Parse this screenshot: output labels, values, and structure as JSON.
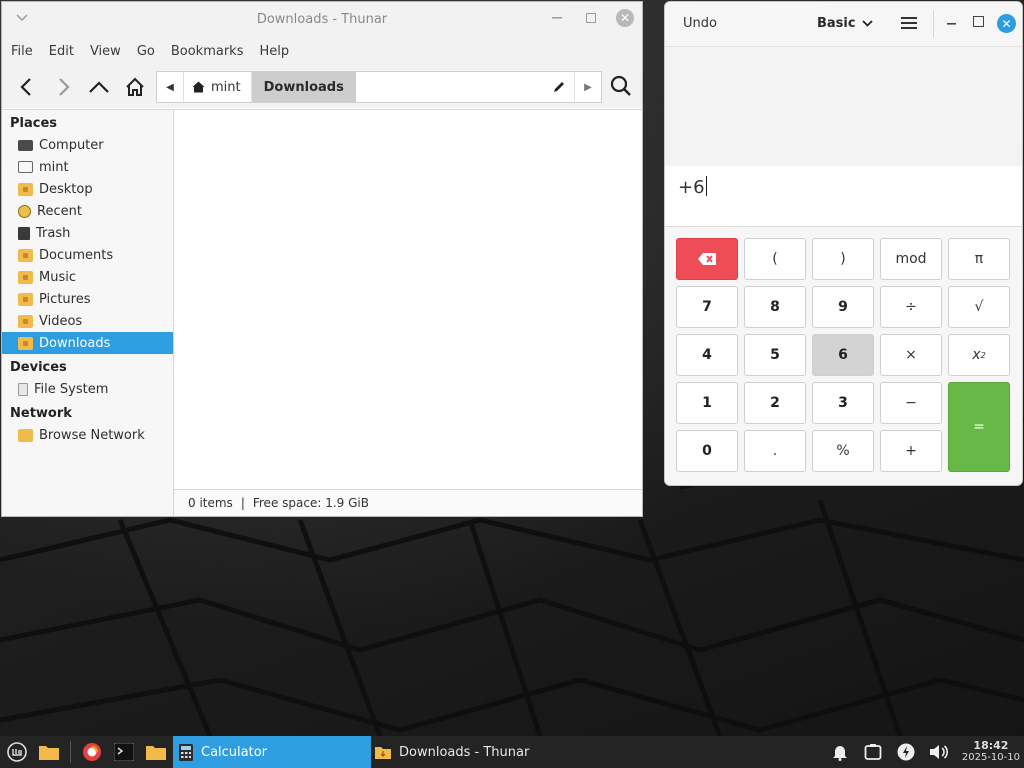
{
  "thunar": {
    "title": "Downloads - Thunar",
    "menu": [
      "File",
      "Edit",
      "View",
      "Go",
      "Bookmarks",
      "Help"
    ],
    "pathbar": {
      "parent": "mint",
      "current": "Downloads"
    },
    "sidebar": {
      "places_header": "Places",
      "places": [
        {
          "label": "Computer",
          "icon": "computer-icon"
        },
        {
          "label": "mint",
          "icon": "home-icon"
        },
        {
          "label": "Desktop",
          "icon": "folder-icon"
        },
        {
          "label": "Recent",
          "icon": "recent-icon"
        },
        {
          "label": "Trash",
          "icon": "trash-icon"
        },
        {
          "label": "Documents",
          "icon": "documents-folder-icon"
        },
        {
          "label": "Music",
          "icon": "music-folder-icon"
        },
        {
          "label": "Pictures",
          "icon": "pictures-folder-icon"
        },
        {
          "label": "Videos",
          "icon": "videos-folder-icon"
        },
        {
          "label": "Downloads",
          "icon": "downloads-folder-icon",
          "active": true
        }
      ],
      "devices_header": "Devices",
      "devices": [
        {
          "label": "File System",
          "icon": "drive-icon"
        }
      ],
      "network_header": "Network",
      "network": [
        {
          "label": "Browse Network",
          "icon": "network-icon"
        }
      ]
    },
    "status": {
      "items": "0 items",
      "separator": "|",
      "free_space": "Free space: 1.9 GiB"
    }
  },
  "calculator": {
    "undo": "Undo",
    "mode": "Basic",
    "expression": "+6",
    "keys": [
      [
        "(",
        ")",
        "mod",
        "π"
      ],
      [
        "7",
        "8",
        "9",
        "÷",
        "√"
      ],
      [
        "4",
        "5",
        "6",
        "×",
        "x"
      ],
      [
        "1",
        "2",
        "3",
        "−",
        "="
      ],
      [
        "0",
        ".",
        "%",
        "+"
      ]
    ],
    "square_sup": "2"
  },
  "taskbar": {
    "tasks": [
      {
        "label": "Calculator",
        "active": true
      },
      {
        "label": "Downloads - Thunar",
        "active": false
      }
    ],
    "clock": {
      "time": "18:42",
      "date": "2025-10-10"
    }
  },
  "colors": {
    "selection": "#2f9ee0",
    "delete_key": "#ee4c57",
    "equals_key": "#68b848",
    "taskbar": "#242424"
  }
}
